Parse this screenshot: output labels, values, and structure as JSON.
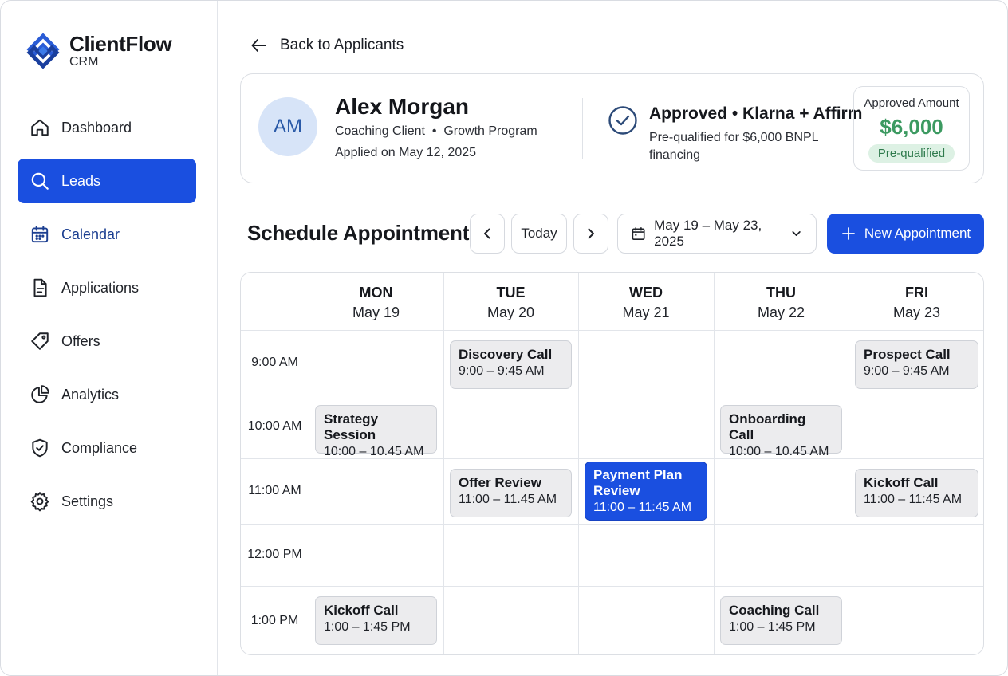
{
  "brand": {
    "name": "ClientFlow",
    "sub": "CRM"
  },
  "nav": [
    {
      "label": "Dashboard",
      "icon": "home-icon"
    },
    {
      "label": "Leads",
      "icon": "search-icon",
      "active": true
    },
    {
      "label": "Calendar",
      "icon": "calendar-icon"
    },
    {
      "label": "Applications",
      "icon": "document-icon"
    },
    {
      "label": "Offers",
      "icon": "tag-icon"
    },
    {
      "label": "Analytics",
      "icon": "pie-chart-icon"
    },
    {
      "label": "Compliance",
      "icon": "shield-check-icon"
    },
    {
      "label": "Settings",
      "icon": "gear-icon"
    }
  ],
  "back": {
    "label": "Back to Applicants"
  },
  "applicant": {
    "initials": "AM",
    "name": "Alex Morgan",
    "line1": "Coaching Client  •  Growth Program",
    "line2": "Applied on May 12, 2025",
    "status_title": "Approved • Klarna + Affirm",
    "status_desc": "Pre-qualified for $6,000 BNPL financing",
    "amount_label": "Approved Amount",
    "amount_value": "$6,000",
    "amount_badge": "Pre-qualified"
  },
  "schedule": {
    "title": "Schedule Appointment",
    "today_label": "Today",
    "range_label": "May 19 – May 23, 2025",
    "new_label": "New Appointment"
  },
  "colors": {
    "accent": "#1a4fe0",
    "success": "#3c9a61",
    "success_bg": "#ddf1e4"
  },
  "days": [
    {
      "name": "MON",
      "date": "May 19"
    },
    {
      "name": "TUE",
      "date": "May 20"
    },
    {
      "name": "WED",
      "date": "May 21"
    },
    {
      "name": "THU",
      "date": "May 22"
    },
    {
      "name": "FRI",
      "date": "May 23"
    }
  ],
  "times": [
    "9:00 AM",
    "10:00 AM",
    "11:00 AM",
    "12:00 PM",
    "1:00 PM"
  ],
  "events": [
    {
      "day": 1,
      "slot": 0,
      "title": "Discovery Call",
      "time": "9:00 – 9:45 AM"
    },
    {
      "day": 4,
      "slot": 0,
      "title": "Prospect Call",
      "time": "9:00 – 9:45 AM"
    },
    {
      "day": 0,
      "slot": 1,
      "title": "Strategy Session",
      "time": "10:00 – 10.45 AM"
    },
    {
      "day": 3,
      "slot": 1,
      "title": "Onboarding Call",
      "time": "10:00 – 10.45 AM"
    },
    {
      "day": 1,
      "slot": 2,
      "title": "Offer Review",
      "time": "11:00 – 11.45 AM"
    },
    {
      "day": 2,
      "slot": 2,
      "title": "Payment Plan Review",
      "time": "11:00 – 11:45 AM",
      "highlight": true
    },
    {
      "day": 4,
      "slot": 2,
      "title": "Kickoff Call",
      "time": "11:00 – 11:45 AM"
    },
    {
      "day": 0,
      "slot": 4,
      "title": "Kickoff Call",
      "time": "1:00 – 1:45 PM"
    },
    {
      "day": 3,
      "slot": 4,
      "title": "Coaching Call",
      "time": "1:00 – 1:45 PM"
    }
  ]
}
